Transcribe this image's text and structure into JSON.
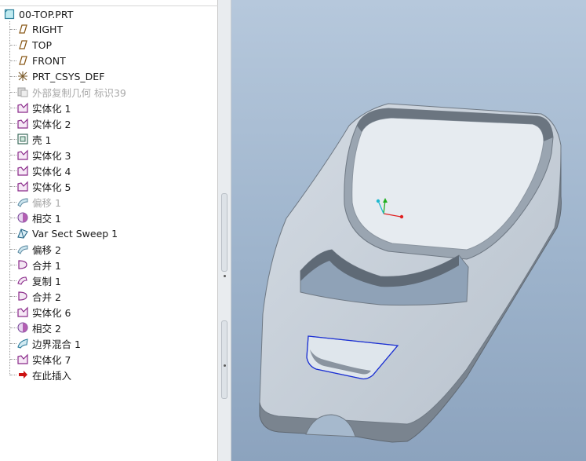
{
  "model_tree": {
    "root": "00-TOP.PRT",
    "items": [
      {
        "label": "RIGHT",
        "icon": "datum-plane-icon",
        "dim": false
      },
      {
        "label": "TOP",
        "icon": "datum-plane-icon",
        "dim": false
      },
      {
        "label": "FRONT",
        "icon": "datum-plane-icon",
        "dim": false
      },
      {
        "label": "PRT_CSYS_DEF",
        "icon": "coordinate-system-icon",
        "dim": false
      },
      {
        "label": "外部复制几何 标识39",
        "icon": "external-copy-geometry-icon",
        "dim": true
      },
      {
        "label": "实体化 1",
        "icon": "solidify-icon",
        "dim": false
      },
      {
        "label": "实体化 2",
        "icon": "solidify-icon",
        "dim": false
      },
      {
        "label": "壳 1",
        "icon": "shell-icon",
        "dim": false
      },
      {
        "label": "实体化 3",
        "icon": "solidify-icon",
        "dim": false
      },
      {
        "label": "实体化 4",
        "icon": "solidify-icon",
        "dim": false
      },
      {
        "label": "实体化 5",
        "icon": "solidify-icon",
        "dim": false
      },
      {
        "label": "偏移 1",
        "icon": "offset-icon",
        "dim": true
      },
      {
        "label": "相交 1",
        "icon": "intersect-icon",
        "dim": false
      },
      {
        "label": "Var Sect Sweep 1",
        "icon": "var-sect-sweep-icon",
        "dim": false
      },
      {
        "label": "偏移 2",
        "icon": "offset-icon",
        "dim": false
      },
      {
        "label": "合并 1",
        "icon": "merge-icon",
        "dim": false
      },
      {
        "label": "复制 1",
        "icon": "copy-icon",
        "dim": false
      },
      {
        "label": "合并 2",
        "icon": "merge-icon",
        "dim": false
      },
      {
        "label": "实体化 6",
        "icon": "solidify-icon",
        "dim": false
      },
      {
        "label": "相交 2",
        "icon": "intersect-icon",
        "dim": false
      },
      {
        "label": "边界混合 1",
        "icon": "boundary-blend-icon",
        "dim": false
      },
      {
        "label": "实体化 7",
        "icon": "solidify-icon",
        "dim": false
      },
      {
        "label": "在此插入",
        "icon": "insert-here-arrow-icon",
        "dim": false
      }
    ]
  },
  "colors": {
    "feature_icon": "#8a2a8a",
    "insert_arrow": "#cc1111",
    "model_face": "#c3ccd6",
    "model_edge": "#6f7984",
    "sketch_outline": "#1a2fd6",
    "axis_x": "#e02020",
    "axis_y": "#20b020",
    "axis_z": "#20b8d0"
  }
}
